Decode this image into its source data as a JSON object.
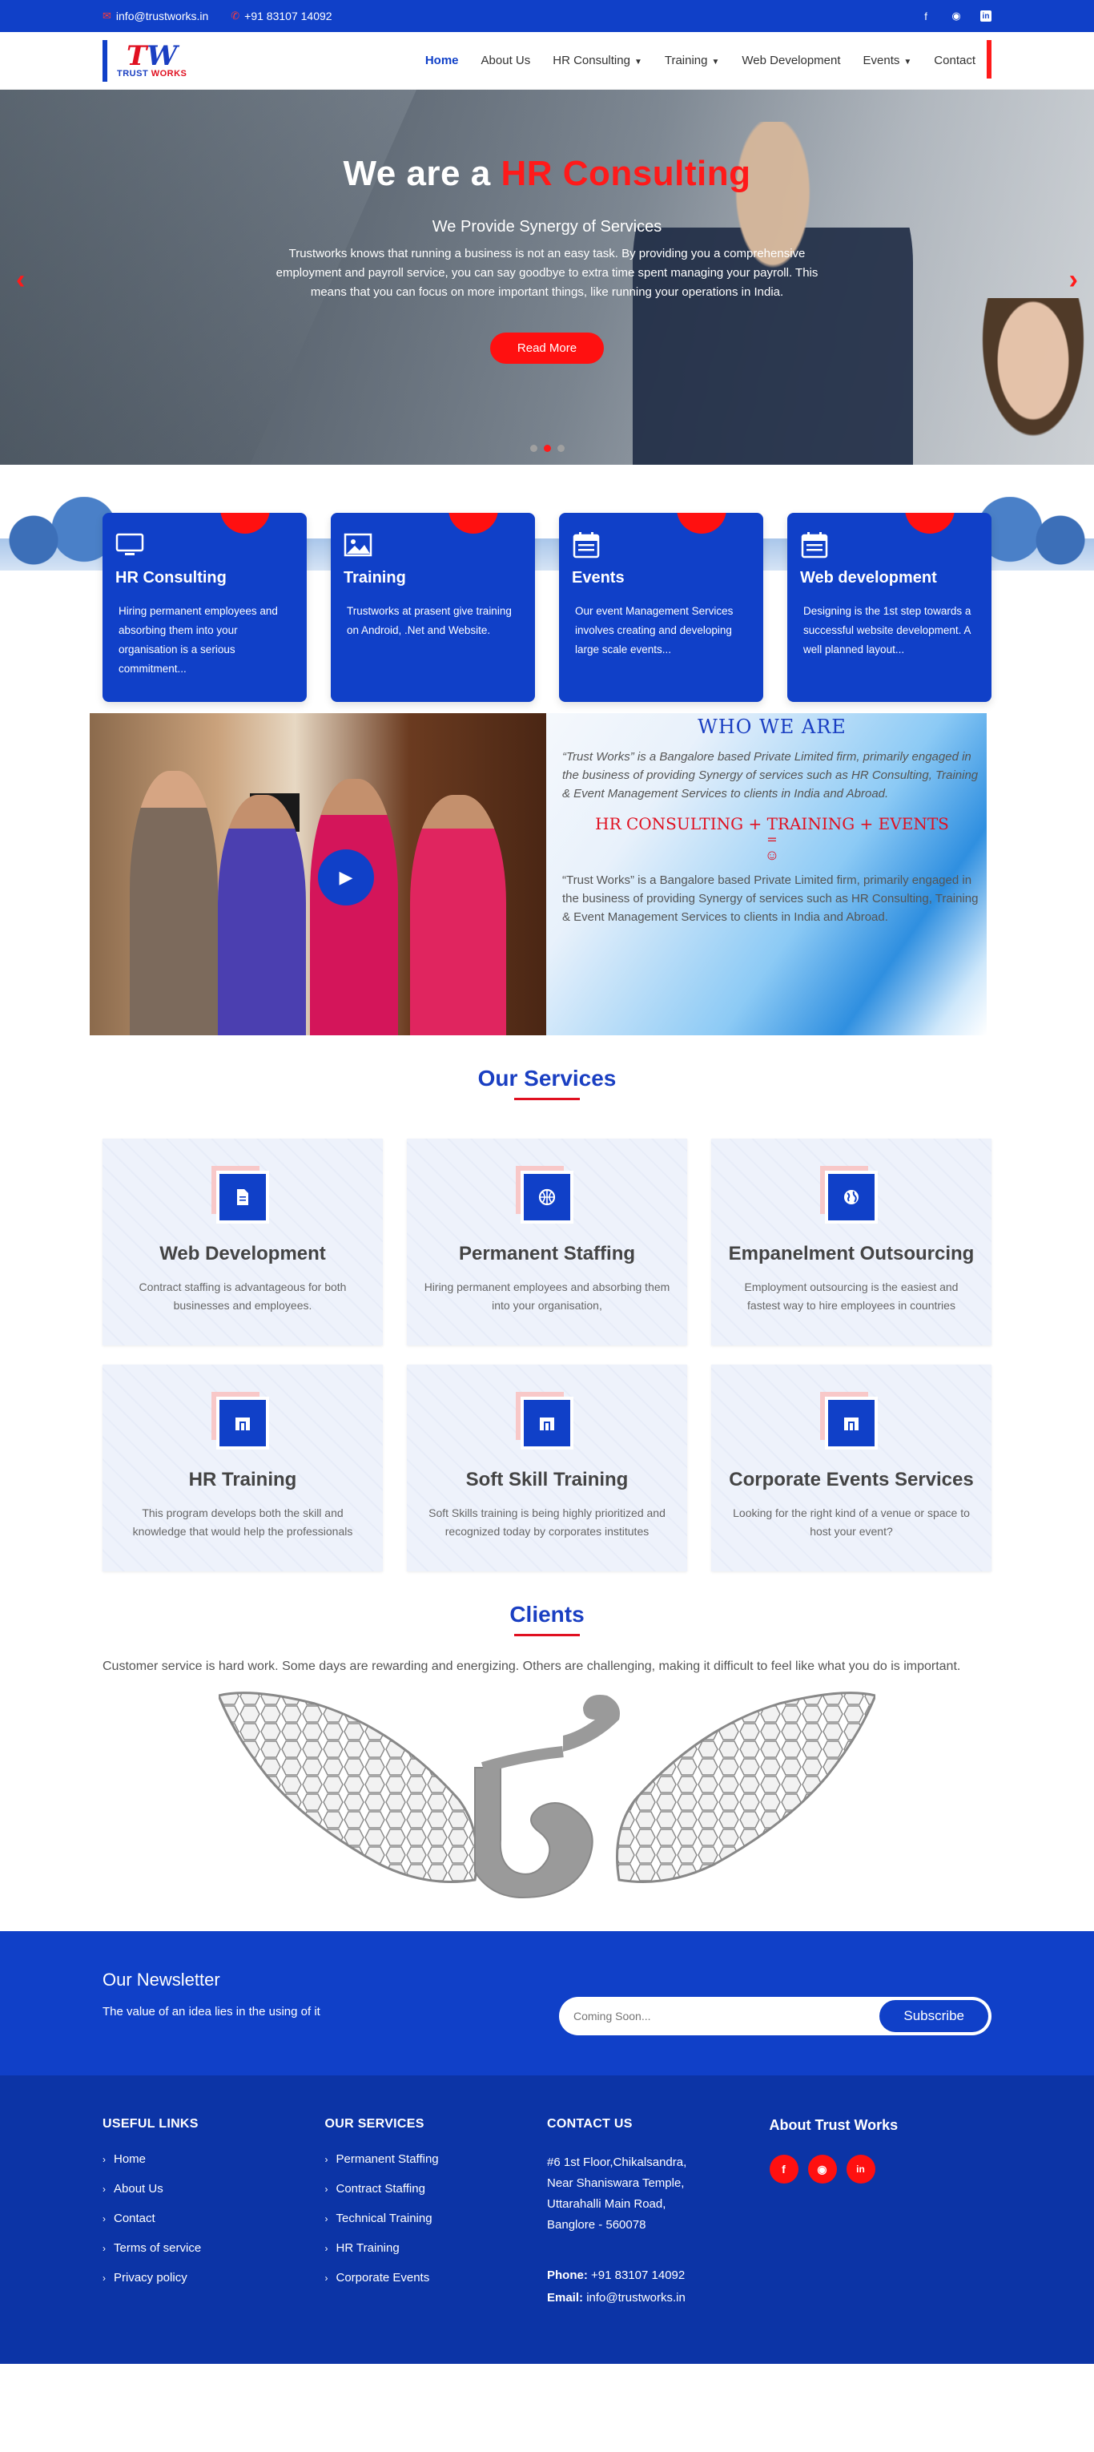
{
  "topbar": {
    "email": "info@trustworks.in",
    "phone": "+91 83107 14092",
    "social": [
      "facebook-icon",
      "whatsapp-icon",
      "linkedin-icon"
    ]
  },
  "brand": {
    "logo_mark_w": "W",
    "logo_mark_t": "T",
    "logo_text_1": "TRUST",
    "logo_text_2": "WORKS"
  },
  "nav": {
    "items": [
      {
        "label": "Home",
        "active": true,
        "dropdown": false
      },
      {
        "label": "About Us",
        "dropdown": false
      },
      {
        "label": "HR Consulting",
        "dropdown": true
      },
      {
        "label": "Training",
        "dropdown": true
      },
      {
        "label": "Web Development",
        "dropdown": false
      },
      {
        "label": "Events",
        "dropdown": true
      },
      {
        "label": "Contact",
        "dropdown": false
      }
    ]
  },
  "hero": {
    "title_prefix": "We are a",
    "title_highlight": "HR Consulting",
    "subtitle": "We Provide Synergy of Services",
    "body": "Trustworks knows that running a business is not an easy task. By providing you a comprehensive employment and payroll service, you can say goodbye to extra time spent managing your payroll. This means that you can focus on more important things, like running your operations in India.",
    "button": "Read More",
    "slides": 3,
    "active_slide": 2
  },
  "features": [
    {
      "icon": "monitor-icon",
      "title": "HR Consulting",
      "text": "Hiring permanent employees and absorbing them into your organisation is a serious commitment..."
    },
    {
      "icon": "image-icon",
      "title": "Training",
      "text": "Trustworks at prasent give training on Android, .Net and Website."
    },
    {
      "icon": "calendar-icon",
      "title": "Events",
      "text": "Our event Management Services involves creating and developing large scale events..."
    },
    {
      "icon": "calendar-icon",
      "title": "Web development",
      "text": "Designing is the 1st step towards a successful website development. A well planned layout..."
    }
  ],
  "who": {
    "title": "WHO WE ARE",
    "para1": "“Trust Works” is a Bangalore based Private Limited firm, primarily engaged in the business of providing Synergy of services such as HR Consulting, Training & Event Management Services to clients in India and Abroad.",
    "equation": "HR CONSULTING + TRAINING + EVENTS",
    "equals": "=",
    "smile": "☺",
    "para2": "“Trust Works” is a Bangalore based Private Limited firm, primarily engaged in the business of providing Synergy of services such as HR Consulting, Training & Event Management Services to clients in India and Abroad."
  },
  "services": {
    "title": "Our Services",
    "items": [
      {
        "icon": "document-icon",
        "title": "Web Development",
        "text": "Contract staffing is advantageous for both businesses and employees."
      },
      {
        "icon": "basketball-icon",
        "title": "Permanent Staffing",
        "text": "Hiring permanent employees and absorbing them into your organisation,"
      },
      {
        "icon": "globe-icon",
        "title": "Empanelment Outsourcing",
        "text": "Employment outsourcing is the easiest and fastest way to hire employees in countries"
      },
      {
        "icon": "building-icon",
        "title": "HR Training",
        "text": "This program develops both the skill and knowledge that would help the professionals"
      },
      {
        "icon": "building-icon",
        "title": "Soft Skill Training",
        "text": "Soft Skills training is being highly prioritized and recognized today by corporates institutes"
      },
      {
        "icon": "building-icon",
        "title": "Corporate Events Services",
        "text": "Looking for the right kind of a venue or space to host your event?"
      }
    ]
  },
  "clients": {
    "title": "Clients",
    "desc": "Customer service is hard work. Some days are rewarding and energizing. Others are challenging, making it difficult to feel like what you do is important."
  },
  "newsletter": {
    "title": "Our Newsletter",
    "text": "The value of an idea lies in the using of it",
    "placeholder": "Coming Soon...",
    "button": "Subscribe"
  },
  "footer": {
    "links_title": "USEFUL LINKS",
    "links": [
      "Home",
      "About Us",
      "Contact",
      "Terms of service",
      "Privacy policy"
    ],
    "services_title": "OUR SERVICES",
    "services": [
      "Permanent Staffing",
      "Contract Staffing",
      "Technical Training",
      "HR Training",
      "Corporate Events"
    ],
    "contact_title": "CONTACT US",
    "address": [
      "#6 1st Floor,Chikalsandra,",
      "Near Shaniswara Temple,",
      "Uttarahalli Main Road,",
      "Banglore - 560078"
    ],
    "phone_label": "Phone:",
    "phone": "+91 83107 14092",
    "email_label": "Email:",
    "email": "info@trustworks.in",
    "about_title": "About Trust Works",
    "social": [
      "facebook-icon",
      "whatsapp-icon",
      "linkedin-icon"
    ]
  },
  "colors": {
    "primary": "#1040c8",
    "accent": "#ff1010",
    "footer": "#0c34a6"
  }
}
